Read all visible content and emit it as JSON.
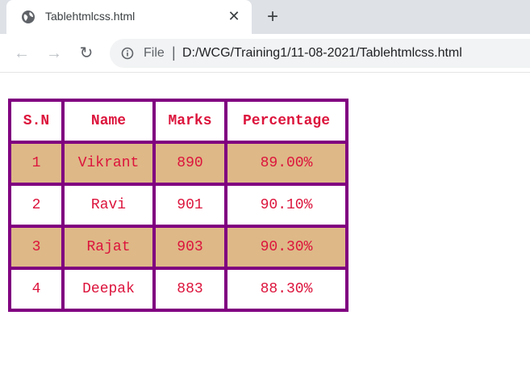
{
  "colors": {
    "accent": "#800080",
    "text": "#dc143c",
    "alt_row": "#deb887"
  },
  "browser": {
    "tab_title": "Tablehtmlcss.html",
    "tab_icon": "globe-icon",
    "close_glyph": "✕",
    "new_tab_glyph": "+",
    "back_glyph": "←",
    "forward_glyph": "→",
    "reload_glyph": "↻",
    "scheme_label": "File",
    "separator": "|",
    "url": "D:/WCG/Training1/11-08-2021/Tablehtmlcss.html"
  },
  "table": {
    "headers": [
      "S.N",
      "Name",
      "Marks",
      "Percentage"
    ],
    "rows": [
      [
        "1",
        "Vikrant",
        "890",
        "89.00%"
      ],
      [
        "2",
        "Ravi",
        "901",
        "90.10%"
      ],
      [
        "3",
        "Rajat",
        "903",
        "90.30%"
      ],
      [
        "4",
        "Deepak",
        "883",
        "88.30%"
      ]
    ]
  }
}
